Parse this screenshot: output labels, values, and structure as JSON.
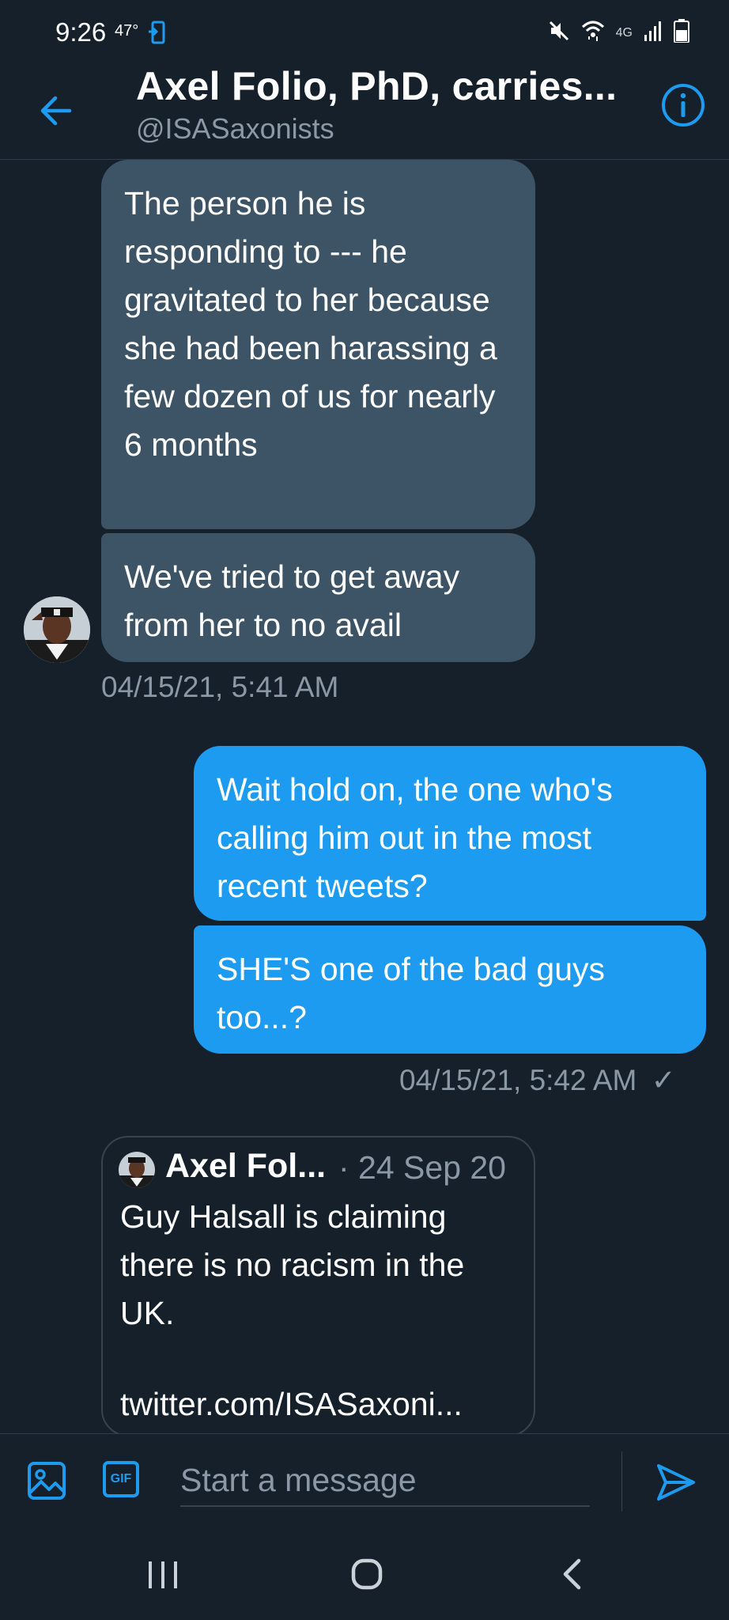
{
  "status_bar": {
    "time": "9:26",
    "temp": "47°",
    "network_label": "4G"
  },
  "header": {
    "title": "Axel Folio, PhD, carries...",
    "handle": "@ISASaxonists"
  },
  "messages": {
    "incoming": {
      "bubble1": "The person he is responding to --- he gravitated to her because she had been harassing a few dozen of us for nearly 6 months",
      "bubble2": "We've tried to get away from her to no avail",
      "timestamp": "04/15/21, 5:41 AM"
    },
    "outgoing": {
      "bubble1": "Wait hold on, the one who's calling him out in the most recent tweets?",
      "bubble2": "SHE'S one of the bad guys too...?",
      "timestamp": "04/15/21, 5:42 AM",
      "read_mark": "✓"
    },
    "quote": {
      "author": "Axel Fol...",
      "date": "· 24 Sep 20",
      "text": "Guy Halsall is claiming there is no racism in the UK.",
      "link": "twitter.com/ISASaxoni..."
    }
  },
  "composer": {
    "placeholder": "Start a message",
    "gif_label": "GIF"
  },
  "colors": {
    "background": "#15202b",
    "accent": "#1d9bf0",
    "incoming_bubble": "#3d5466",
    "muted_text": "#8b98a5"
  },
  "icons": [
    "phone-sync-icon",
    "mute-icon",
    "wifi-icon",
    "signal-icon",
    "battery-icon",
    "back-arrow-icon",
    "info-icon",
    "image-icon",
    "gif-icon",
    "send-icon",
    "recents-icon",
    "home-icon",
    "nav-back-icon"
  ]
}
